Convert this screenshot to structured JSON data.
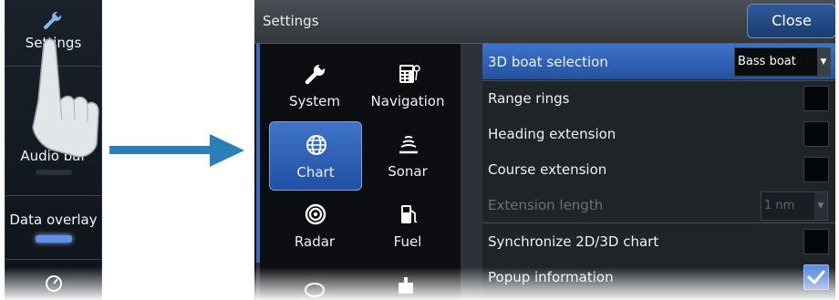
{
  "side_menu": {
    "items": [
      {
        "label": "Settings",
        "icon": "wrench-icon"
      },
      {
        "label": "Audio bar"
      },
      {
        "label": "Data overlay"
      }
    ],
    "bottom_icon": "gauge-icon"
  },
  "settings_window": {
    "title": "Settings",
    "close_label": "Close",
    "categories": [
      {
        "label": "System",
        "icon": "wrench-icon"
      },
      {
        "label": "Navigation",
        "icon": "calculator-icon"
      },
      {
        "label": "Chart",
        "icon": "globe-icon",
        "selected": true
      },
      {
        "label": "Sonar",
        "icon": "sonar-icon"
      },
      {
        "label": "Radar",
        "icon": "radar-icon"
      },
      {
        "label": "Fuel",
        "icon": "fuel-pump-icon"
      }
    ],
    "options": [
      {
        "label": "3D boat selection",
        "value": "Bass boat",
        "selected": true
      },
      {
        "label": "Range rings",
        "checked": false
      },
      {
        "label": "Heading extension",
        "checked": false
      },
      {
        "label": "Course extension",
        "checked": false
      },
      {
        "label": "Extension length",
        "value": "1 nm",
        "disabled": true
      },
      {
        "label": "Synchronize 2D/3D chart",
        "checked": false
      },
      {
        "label": "Popup information",
        "checked": true
      }
    ]
  },
  "colors": {
    "accent": "#3e74c9",
    "arrow": "#2a7fb8"
  }
}
